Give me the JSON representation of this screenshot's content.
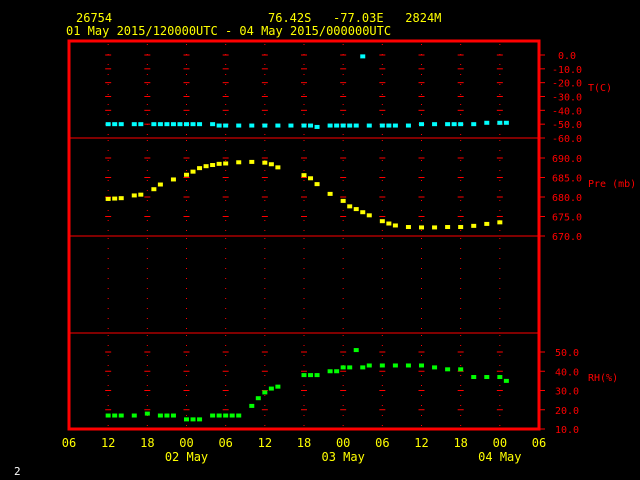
{
  "header": {
    "station": "26754",
    "location": "76.42S   -77.03E   2824M",
    "period": "01 May 2015/120000UTC - 04 May 2015/000000UTC"
  },
  "page_number": "2",
  "colors": {
    "frame": "#ff0000",
    "temperature": "#00ffff",
    "pressure": "#ffff00",
    "humidity": "#00ff00",
    "header_text": "#ffff00",
    "grid": "#ff0000"
  },
  "x_axis": {
    "hour_ticks": [
      "06",
      "12",
      "18",
      "00",
      "06",
      "12",
      "18",
      "00",
      "06",
      "12",
      "18",
      "00",
      "06"
    ],
    "day_labels": [
      {
        "text": "02 May",
        "hours_from_start": 18
      },
      {
        "text": "03 May",
        "hours_from_start": 42
      },
      {
        "text": "04 May",
        "hours_from_start": 66
      }
    ]
  },
  "chart_data": [
    {
      "type": "scatter",
      "ylabel": "T(C)",
      "ylim": [
        -60,
        0
      ],
      "yticks": [
        "0.0",
        "-10.0",
        "-20.0",
        "-30.0",
        "-40.0",
        "-50.0",
        "-60.0"
      ],
      "ytick_values": [
        0,
        -10,
        -20,
        -30,
        -40,
        -50,
        -60
      ],
      "x_units": "hours after 01 May 2015 06 UTC",
      "xlim": [
        0,
        72
      ],
      "x": [
        6,
        7,
        8,
        10,
        11,
        13,
        14,
        15,
        16,
        17,
        18,
        19,
        20,
        22,
        23,
        24,
        26,
        28,
        30,
        32,
        34,
        36,
        37,
        38,
        40,
        41,
        42,
        43,
        44,
        45,
        46,
        48,
        49,
        50,
        52,
        54,
        56,
        58,
        59,
        60,
        62,
        64,
        66,
        67
      ],
      "y": [
        -50,
        -50,
        -50,
        -50,
        -50,
        -50,
        -50,
        -50,
        -50,
        -50,
        -50,
        -50,
        -50,
        -50,
        -51,
        -51,
        -51,
        -51,
        -51,
        -51,
        -51,
        -51,
        -51,
        -52,
        -51,
        -51,
        -51,
        -51,
        -51,
        -1,
        -51,
        -51,
        -51,
        -51,
        -51,
        -50,
        -50,
        -50,
        -50,
        -50,
        -50,
        -49,
        -49,
        -49
      ],
      "grid": true
    },
    {
      "type": "scatter",
      "ylabel": "Pre (mb)",
      "ylim": [
        670,
        690
      ],
      "yticks": [
        "690.0",
        "685.0",
        "680.0",
        "675.0",
        "670.0"
      ],
      "ytick_values": [
        690,
        685,
        680,
        675,
        670
      ],
      "x_units": "hours after 01 May 2015 06 UTC",
      "xlim": [
        0,
        72
      ],
      "x": [
        6,
        7,
        8,
        10,
        11,
        13,
        14,
        16,
        18,
        19,
        20,
        21,
        22,
        23,
        24,
        26,
        28,
        30,
        31,
        32,
        36,
        37,
        38,
        40,
        42,
        43,
        44,
        45,
        46,
        48,
        49,
        50,
        52,
        54,
        56,
        58,
        60,
        62,
        64,
        66
      ],
      "y": [
        679.5,
        679.6,
        679.7,
        680.4,
        680.6,
        682.0,
        683.2,
        684.5,
        685.7,
        686.5,
        687.4,
        687.9,
        688.2,
        688.5,
        688.6,
        688.9,
        689.0,
        688.8,
        688.4,
        687.6,
        685.6,
        684.8,
        683.3,
        680.8,
        679.0,
        677.6,
        676.9,
        676.1,
        675.3,
        673.8,
        673.2,
        672.7,
        672.3,
        672.2,
        672.2,
        672.3,
        672.3,
        672.6,
        673.1,
        673.5
      ],
      "grid": true
    },
    {
      "type": "scatter",
      "ylabel": "RH(%)",
      "ylim": [
        10,
        50
      ],
      "yticks": [
        "50.0",
        "40.0",
        "30.0",
        "20.0",
        "10.0"
      ],
      "ytick_values": [
        50,
        40,
        30,
        20,
        10
      ],
      "x_units": "hours after 01 May 2015 06 UTC",
      "xlim": [
        0,
        72
      ],
      "x": [
        6,
        7,
        8,
        10,
        12,
        14,
        15,
        16,
        18,
        19,
        20,
        22,
        23,
        24,
        25,
        26,
        28,
        29,
        30,
        31,
        32,
        36,
        37,
        38,
        40,
        41,
        42,
        43,
        44,
        45,
        46,
        48,
        50,
        52,
        54,
        56,
        58,
        60,
        62,
        64,
        66,
        67
      ],
      "y": [
        17,
        17,
        17,
        17,
        18,
        17,
        17,
        17,
        15,
        15,
        15,
        17,
        17,
        17,
        17,
        17,
        22,
        26,
        29,
        31,
        32,
        38,
        38,
        38,
        40,
        40,
        42,
        42,
        51,
        42,
        43,
        43,
        43,
        43,
        43,
        42,
        41,
        41,
        37,
        37,
        37,
        35
      ],
      "grid": true
    }
  ]
}
